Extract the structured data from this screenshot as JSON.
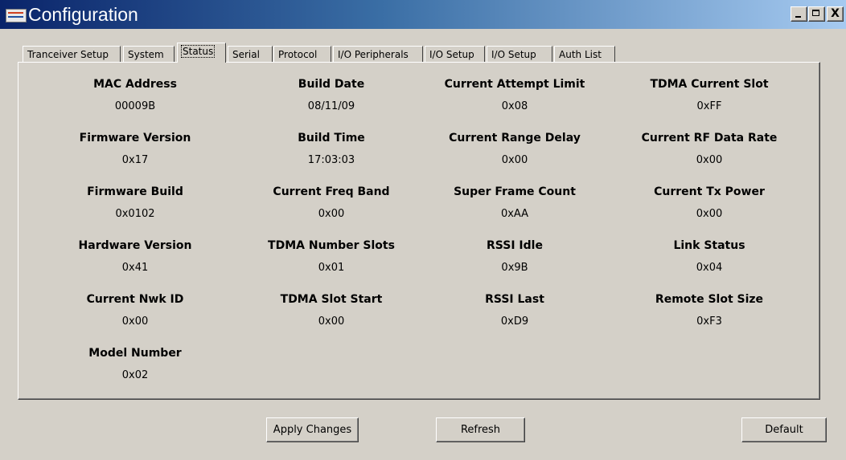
{
  "window": {
    "title": "Configuration",
    "icon_text": "RFIC",
    "minimize_label": "_",
    "maximize_label": "□",
    "close_label": "X"
  },
  "tabs": [
    {
      "label": "Tranceiver Setup",
      "active": false
    },
    {
      "label": "System",
      "active": false
    },
    {
      "label": "Status",
      "active": true
    },
    {
      "label": "Serial",
      "active": false
    },
    {
      "label": "Protocol",
      "active": false
    },
    {
      "label": "I/O Peripherals",
      "active": false
    },
    {
      "label": "I/O Setup",
      "active": false
    },
    {
      "label": "I/O Setup",
      "active": false
    },
    {
      "label": "Auth List",
      "active": false
    }
  ],
  "status": {
    "col1": [
      {
        "label": "MAC Address",
        "value": "00009B"
      },
      {
        "label": "Firmware Version",
        "value": "0x17"
      },
      {
        "label": "Firmware Build",
        "value": "0x0102"
      },
      {
        "label": "Hardware Version",
        "value": "0x41"
      },
      {
        "label": "Current Nwk ID",
        "value": "0x00"
      },
      {
        "label": "Model Number",
        "value": "0x02"
      }
    ],
    "col2": [
      {
        "label": "Build Date",
        "value": "08/11/09"
      },
      {
        "label": "Build Time",
        "value": "17:03:03"
      },
      {
        "label": "Current Freq Band",
        "value": "0x00"
      },
      {
        "label": "TDMA Number Slots",
        "value": "0x01"
      },
      {
        "label": "TDMA Slot Start",
        "value": "0x00"
      }
    ],
    "col3": [
      {
        "label": "Current Attempt Limit",
        "value": "0x08"
      },
      {
        "label": "Current Range Delay",
        "value": "0x00"
      },
      {
        "label": "Super Frame Count",
        "value": "0xAA"
      },
      {
        "label": "RSSI Idle",
        "value": "0x9B"
      },
      {
        "label": "RSSI Last",
        "value": "0xD9"
      }
    ],
    "col4": [
      {
        "label": "TDMA Current Slot",
        "value": "0xFF"
      },
      {
        "label": "Current RF Data Rate",
        "value": "0x00"
      },
      {
        "label": "Current Tx Power",
        "value": "0x00"
      },
      {
        "label": "Link Status",
        "value": "0x04"
      },
      {
        "label": "Remote Slot Size",
        "value": "0xF3"
      }
    ]
  },
  "buttons": {
    "apply": "Apply Changes",
    "refresh": "Refresh",
    "default": "Default"
  }
}
